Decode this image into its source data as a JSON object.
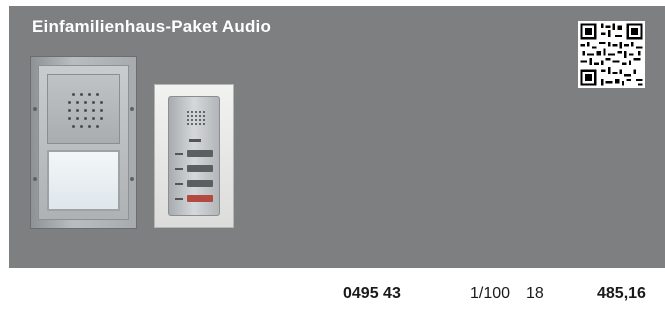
{
  "panel": {
    "title": "Einfamilienhaus-Paket Audio",
    "background": "#7e7f81"
  },
  "images": {
    "qr_code": "qr-code",
    "outdoor_station": "door-station-audio",
    "indoor_station": "indoor-audio-station"
  },
  "product": {
    "article_number": "0495 43",
    "packaging": "1/100",
    "group": "18",
    "price": "485,16"
  }
}
